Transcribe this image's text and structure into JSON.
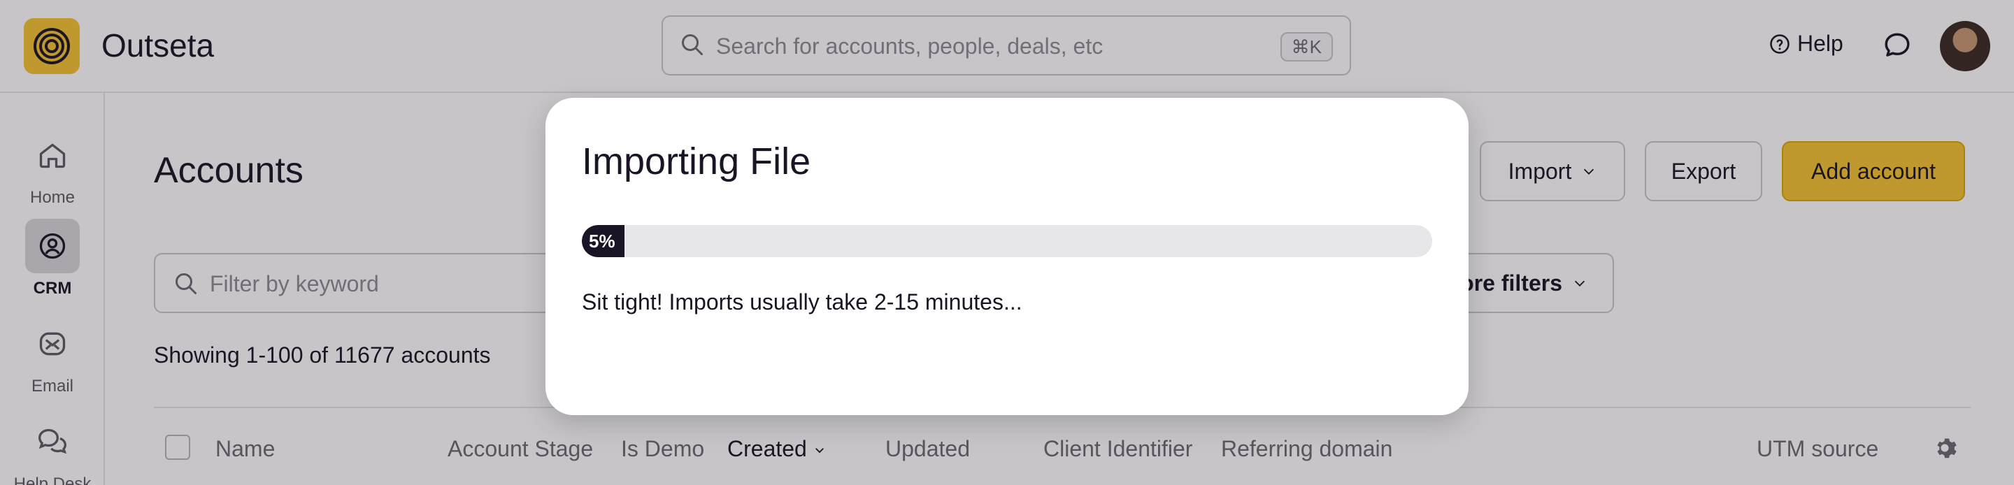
{
  "app": {
    "brand": "Outseta"
  },
  "search": {
    "placeholder": "Search for accounts, people, deals, etc",
    "shortcut": "⌘K"
  },
  "header": {
    "help_label": "Help"
  },
  "sidebar": {
    "items": [
      {
        "label": "Home",
        "icon": "home-icon",
        "active": false
      },
      {
        "label": "CRM",
        "icon": "crm-icon",
        "active": true
      },
      {
        "label": "Email",
        "icon": "email-icon",
        "active": false
      },
      {
        "label": "Help Desk",
        "icon": "help-desk-icon",
        "active": false
      }
    ]
  },
  "main": {
    "title": "Accounts",
    "import_label": "Import",
    "export_label": "Export",
    "add_label": "Add account",
    "filter_placeholder": "Filter by keyword",
    "more_filters_label": "ore filters",
    "showing": "Showing 1-100 of 11677 accounts",
    "columns": [
      "Name",
      "Account Stage",
      "Is Demo",
      "Created",
      "Updated",
      "Client Identifier",
      "Referring domain",
      "UTM source"
    ],
    "sorted_column": "Created"
  },
  "modal": {
    "title": "Importing File",
    "progress": 0.05,
    "progress_label": "5%",
    "message": "Sit tight! Imports usually take 2-15 minutes..."
  },
  "colors": {
    "accent": "#f4c430",
    "text": "#1b1424",
    "muted": "#6c6872",
    "progress_fill": "#1b1424",
    "progress_track": "#e7e6e9"
  }
}
